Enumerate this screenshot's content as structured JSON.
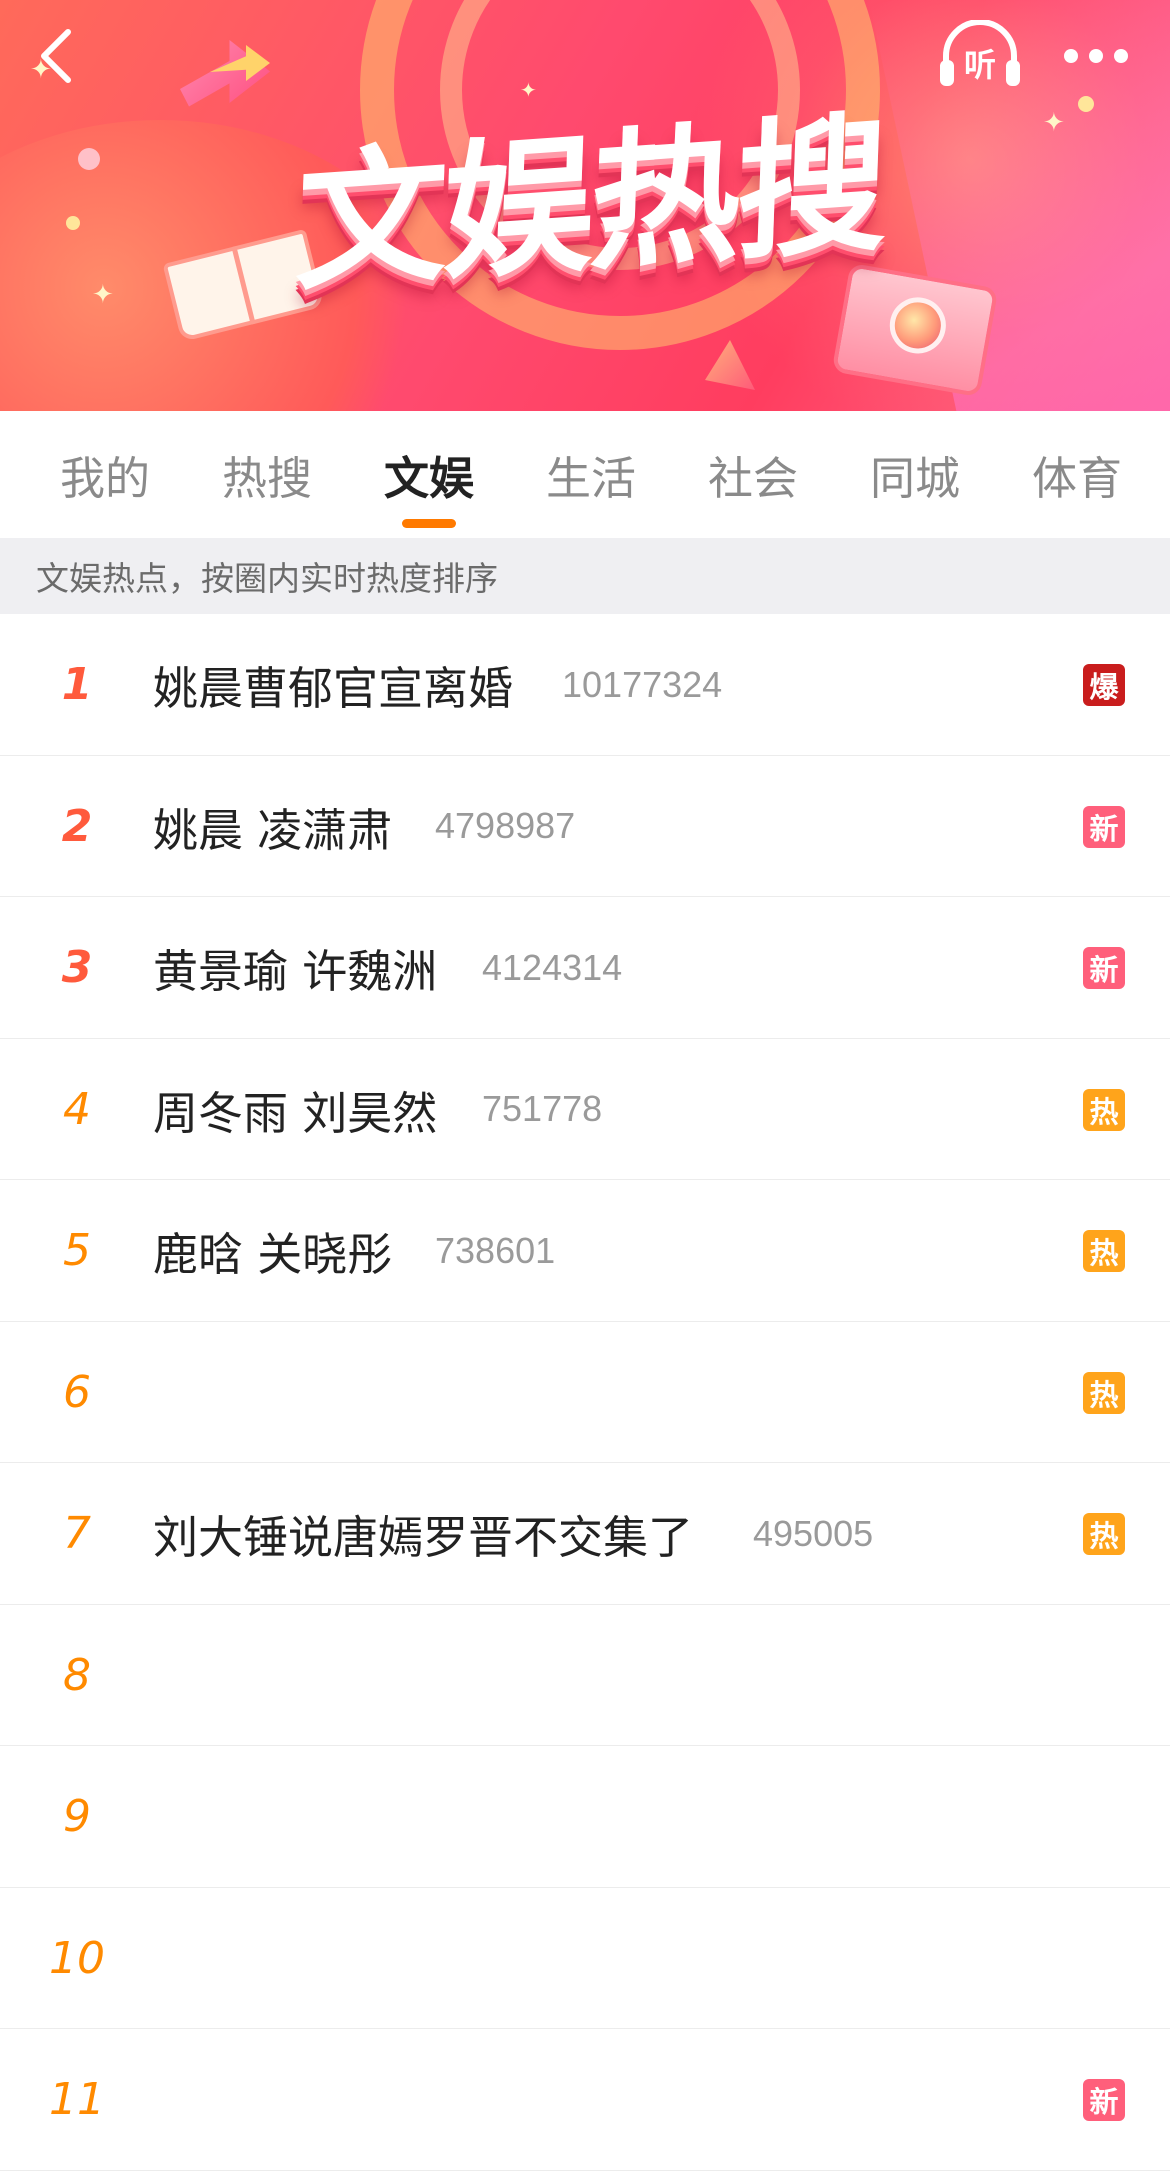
{
  "header": {
    "title": "文娱热搜",
    "listen_label": "听",
    "back_icon": "chevron-left-icon",
    "more_icon": "more-dots-icon",
    "colors": {
      "banner_start": "#ff6a5a",
      "banner_end": "#ff6f8c",
      "accent": "#ff7a00"
    }
  },
  "tabs": [
    {
      "label": "我的",
      "active": false
    },
    {
      "label": "热搜",
      "active": false
    },
    {
      "label": "文娱",
      "active": true
    },
    {
      "label": "生活",
      "active": false
    },
    {
      "label": "社会",
      "active": false
    },
    {
      "label": "同城",
      "active": false
    },
    {
      "label": "体育",
      "active": false
    }
  ],
  "subtitle": "文娱热点，按圈内实时热度排序",
  "list": [
    {
      "rank": "1",
      "title": "姚晨曹郁官宣离婚",
      "count": "10177324",
      "badge": "爆",
      "badge_type": "bao"
    },
    {
      "rank": "2",
      "title": "姚晨 凌潇肃",
      "count": "4798987",
      "badge": "新",
      "badge_type": "xin"
    },
    {
      "rank": "3",
      "title": "黄景瑜 许魏洲",
      "count": "4124314",
      "badge": "新",
      "badge_type": "xin"
    },
    {
      "rank": "4",
      "title": "周冬雨 刘昊然",
      "count": "751778",
      "badge": "热",
      "badge_type": "re"
    },
    {
      "rank": "5",
      "title": "鹿晗 关晓彤",
      "count": "738601",
      "badge": "热",
      "badge_type": "re"
    },
    {
      "rank": "6",
      "title": "",
      "count": "",
      "badge": "热",
      "badge_type": "re"
    },
    {
      "rank": "7",
      "title": "刘大锤说唐嫣罗晋不交集了",
      "count": "495005",
      "badge": "热",
      "badge_type": "re"
    },
    {
      "rank": "8",
      "title": "",
      "count": "",
      "badge": "",
      "badge_type": ""
    },
    {
      "rank": "9",
      "title": "",
      "count": "",
      "badge": "",
      "badge_type": ""
    },
    {
      "rank": "10",
      "title": "",
      "count": "",
      "badge": "",
      "badge_type": ""
    },
    {
      "rank": "11",
      "title": "",
      "count": "",
      "badge": "新",
      "badge_type": "xin"
    }
  ]
}
